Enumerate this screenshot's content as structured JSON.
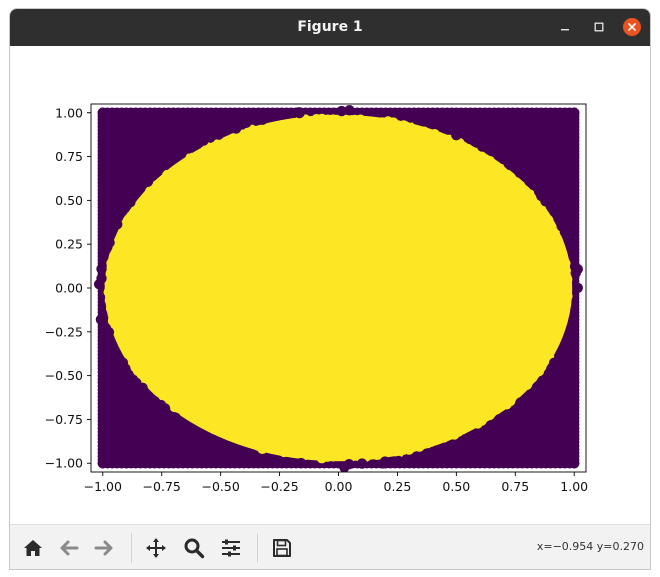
{
  "window": {
    "title": "Figure 1",
    "close_color": "#e95420"
  },
  "toolbar": {
    "buttons": [
      "home-icon",
      "back-icon",
      "forward-icon",
      "pan-icon",
      "zoom-icon",
      "configure-subplots-icon",
      "save-icon"
    ],
    "coords_text": "x=−0.954 y=0.270"
  },
  "chart_data": {
    "type": "scatter",
    "title": "",
    "xlabel": "",
    "ylabel": "",
    "xlim": [
      -1.05,
      1.05
    ],
    "ylim": [
      -1.05,
      1.05
    ],
    "xticks": [
      "−1.00",
      "−0.75",
      "−0.50",
      "−0.25",
      "0.00",
      "0.25",
      "0.50",
      "0.75",
      "1.00"
    ],
    "xtick_values": [
      -1.0,
      -0.75,
      -0.5,
      -0.25,
      0.0,
      0.25,
      0.5,
      0.75,
      1.0
    ],
    "yticks": [
      "1.00",
      "0.75",
      "0.50",
      "0.25",
      "0.00",
      "−0.25",
      "−0.50",
      "−0.75",
      "−1.00"
    ],
    "ytick_values": [
      1.0,
      0.75,
      0.5,
      0.25,
      0.0,
      -0.25,
      -0.5,
      -0.75,
      -1.0
    ],
    "grid": false,
    "series": [
      {
        "color": "#440154",
        "region": "outside circle x^2+y^2>1 within square [-1,1]x[-1,1]"
      },
      {
        "color": "#fde725",
        "region": "inside circle x^2+y^2<=1"
      }
    ]
  }
}
